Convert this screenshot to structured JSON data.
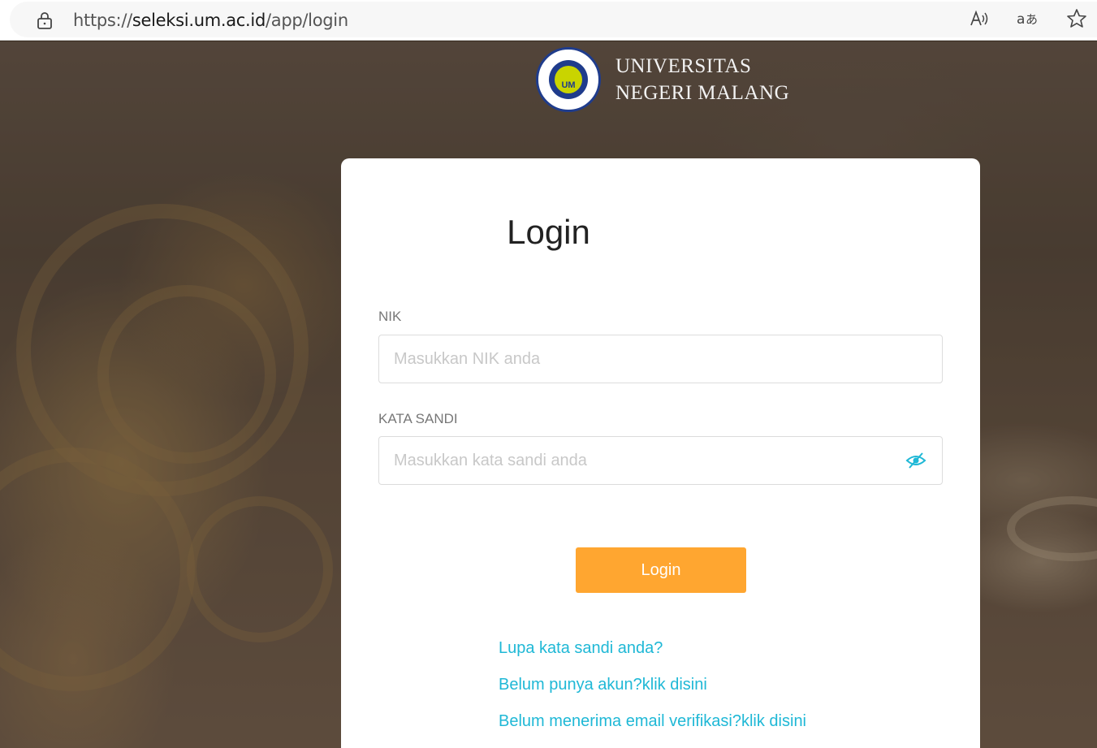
{
  "browser": {
    "url_scheme": "https://",
    "url_host": "seleksi.um.ac.id",
    "url_path": "/app/login",
    "icons": [
      "lock-icon",
      "read-aloud-icon",
      "translate-icon",
      "favorite-star-icon"
    ]
  },
  "logo": {
    "line1": "UNIVERSITAS",
    "line2": "NEGERI MALANG",
    "seal_text": "UM",
    "colors": {
      "seal_blue": "#1f3c8c",
      "seal_yellow": "#c9d400"
    }
  },
  "login": {
    "title": "Login",
    "nik_label": "NIK",
    "nik_placeholder": "Masukkan NIK anda",
    "nik_value": "",
    "password_label": "KATA SANDI",
    "password_placeholder": "Masukkan kata sandi anda",
    "password_value": "",
    "submit_label": "Login",
    "links": {
      "forgot": "Lupa kata sandi anda?",
      "register": "Belum punya akun?klik disini",
      "resend": "Belum menerima email verifikasi?klik disini"
    }
  },
  "colors": {
    "accent_button": "#ffa630",
    "link": "#1fb8d6",
    "eye_icon": "#1fb8d6"
  }
}
